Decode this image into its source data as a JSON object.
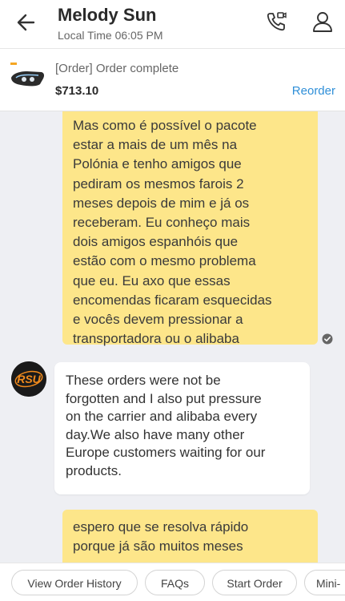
{
  "header": {
    "contact_name": "Melody Sun",
    "local_time": "Local Time 06:05 PM",
    "icons": {
      "back": "arrow-left-icon",
      "call": "phone-video-icon",
      "profile": "user-icon"
    }
  },
  "order": {
    "status": "[Order]  Order complete",
    "price": "$713.10",
    "reorder_label": "Reorder",
    "thumbnail": "headlight-icon"
  },
  "messages": [
    {
      "direction": "outgoing",
      "text": "Mas como é possível o pacote\nestar a mais de um mês na\nPolónia e tenho amigos que\npediram os mesmos farois 2\nmeses depois de mim e já os\nreceberam. Eu conheço mais\ndois amigos espanhóis que\nestão com o mesmo problema\nque eu. Eu axo que essas\nencomendas ficaram esquecidas\ne vocês devem pressionar a\ntransportadora ou o alibaba",
      "status_icon": "read-check-icon"
    },
    {
      "direction": "incoming",
      "avatar_text": "RSU",
      "text": "These orders were not be\nforgotten and I also  put pressure\non the carrier and alibaba every\nday.We also have many other\nEurope customers waiting for our\nproducts."
    },
    {
      "direction": "outgoing",
      "text": "espero que se resolva rápido\nporque já são muitos meses"
    }
  ],
  "quick_actions": [
    "View Order History",
    "FAQs",
    "Start Order",
    "Mini-"
  ],
  "colors": {
    "outgoing_bubble": "#fde68a",
    "link": "#2f8fd8",
    "background": "#eeeff3",
    "logo_accent": "#f08a1c"
  }
}
